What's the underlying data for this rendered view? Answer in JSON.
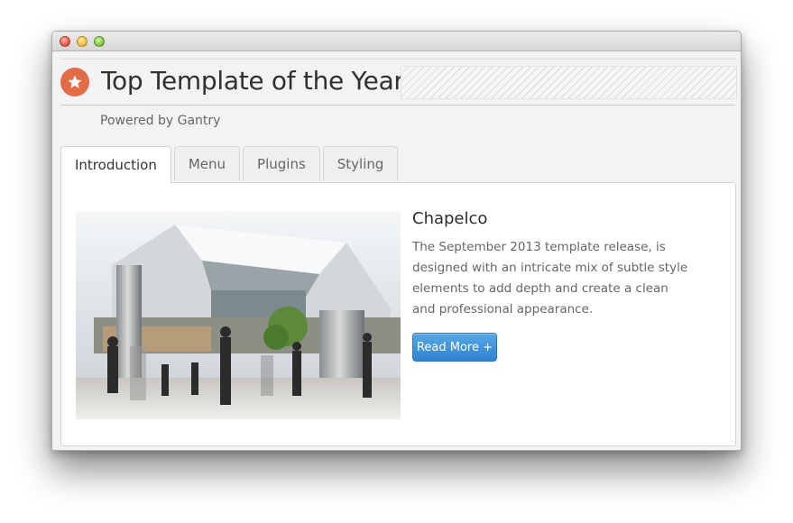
{
  "window": {
    "controls": {
      "close": "close-icon",
      "minimize": "minimize-icon",
      "zoom": "zoom-icon"
    }
  },
  "header": {
    "logo_icon": "star-icon",
    "title": "Top Template of the Year",
    "tagline": "Powered by Gantry",
    "accent_color": "#e26c45"
  },
  "tabs": [
    {
      "label": "Introduction",
      "active": true
    },
    {
      "label": "Menu",
      "active": false
    },
    {
      "label": "Plugins",
      "active": false
    },
    {
      "label": "Styling",
      "active": false
    }
  ],
  "content": {
    "image_alt": "Shopping mall atrium with people walking",
    "title": "Chapelco",
    "body": "The September 2013 template release, is designed with an intricate mix of subtle style elements to add depth and create a clean and professional appearance.",
    "read_more_label": "Read More +",
    "button_color": "#3a8fd8"
  }
}
